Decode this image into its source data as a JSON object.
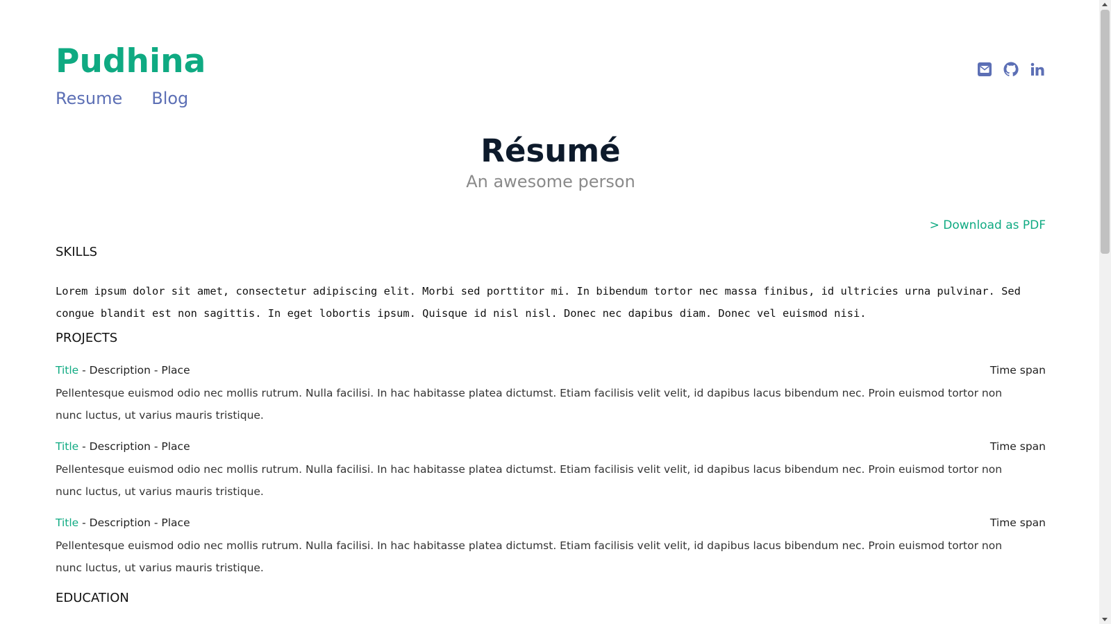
{
  "header": {
    "site_title": "Pudhina",
    "nav": [
      "Resume",
      "Blog"
    ],
    "social_icons": [
      "envelope-square-icon",
      "github-icon",
      "linkedin-icon"
    ]
  },
  "hero": {
    "title": "Résumé",
    "subtitle": "An awesome person"
  },
  "download_link": "> Download as PDF",
  "sections": {
    "skills": {
      "heading": "SKILLS",
      "text": "Lorem ipsum dolor sit amet, consectetur adipiscing elit. Morbi sed porttitor mi. In bibendum tortor nec massa finibus, id ultricies urna pulvinar. Sed congue blandit est non sagittis. In eget lobortis ipsum. Quisque id nisl nisl. Donec nec dapibus diam. Donec vel euismod nisi."
    },
    "projects": {
      "heading": "PROJECTS",
      "items": [
        {
          "title": "Title",
          "meta": " - Description - Place",
          "time": "Time span",
          "description": "Pellentesque euismod odio nec mollis rutrum. Nulla facilisi. In hac habitasse platea dictumst. Etiam facilisis velit velit, id dapibus lacus bibendum nec. Proin euismod tortor non nunc luctus, ut varius mauris tristique."
        },
        {
          "title": "Title",
          "meta": " - Description - Place",
          "time": "Time span",
          "description": "Pellentesque euismod odio nec mollis rutrum. Nulla facilisi. In hac habitasse platea dictumst. Etiam facilisis velit velit, id dapibus lacus bibendum nec. Proin euismod tortor non nunc luctus, ut varius mauris tristique."
        },
        {
          "title": "Title",
          "meta": " - Description - Place",
          "time": "Time span",
          "description": "Pellentesque euismod odio nec mollis rutrum. Nulla facilisi. In hac habitasse platea dictumst. Etiam facilisis velit velit, id dapibus lacus bibendum nec. Proin euismod tortor non nunc luctus, ut varius mauris tristique."
        }
      ]
    },
    "education": {
      "heading": "EDUCATION"
    }
  },
  "colors": {
    "accent": "#0faa82",
    "nav_link": "#5c6fb5",
    "heading": "#0d1a2b",
    "subtitle": "#8a8a8a"
  }
}
